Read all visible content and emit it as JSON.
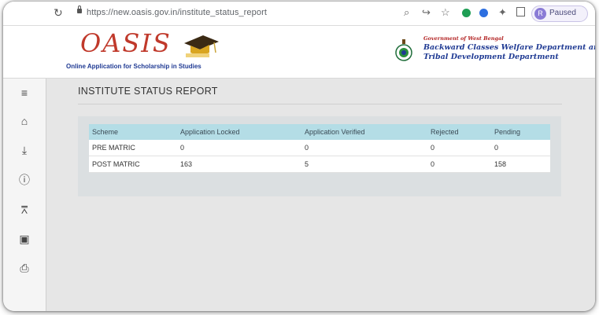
{
  "browser": {
    "url": "https://new.oasis.gov.in/institute_status_report",
    "profile_initial": "R",
    "profile_status": "Paused"
  },
  "header": {
    "logo": "OASIS",
    "tagline": "Online Application for Scholarship in Studies",
    "gov_line1": "Government of West Bengal",
    "gov_line2": "Backward Classes Welfare Department and",
    "gov_line3": "Tribal Development Department"
  },
  "sidebar": {
    "items": [
      {
        "icon": "menu-icon"
      },
      {
        "icon": "home-icon"
      },
      {
        "icon": "download-icon"
      },
      {
        "icon": "info-icon"
      },
      {
        "icon": "institution-icon"
      },
      {
        "icon": "lock-icon"
      },
      {
        "icon": "print-icon"
      }
    ]
  },
  "main": {
    "title": "INSTITUTE STATUS REPORT",
    "table": {
      "columns": [
        "Scheme",
        "Application Locked",
        "Application Verified",
        "Rejected",
        "Pending"
      ],
      "rows": [
        [
          "PRE MATRIC",
          "0",
          "0",
          "0",
          "0"
        ],
        [
          "POST MATRIC",
          "163",
          "5",
          "0",
          "158"
        ]
      ]
    }
  },
  "colors": {
    "table_header_bg": "#b4dde6",
    "logo_red": "#c0392b",
    "gov_blue": "#1f3a93"
  }
}
